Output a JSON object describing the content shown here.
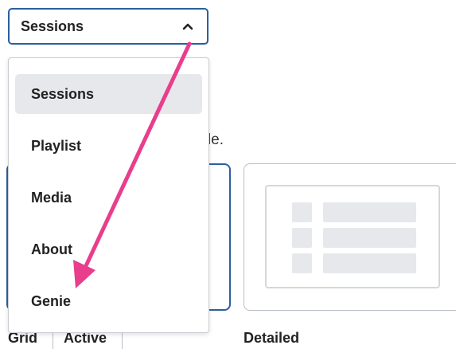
{
  "select": {
    "value": "Sessions",
    "expanded": true
  },
  "menu": {
    "items": [
      {
        "label": "Sessions",
        "selected": true
      },
      {
        "label": "Playlist",
        "selected": false
      },
      {
        "label": "Media",
        "selected": false
      },
      {
        "label": "About",
        "selected": false
      },
      {
        "label": "Genie",
        "selected": false
      }
    ]
  },
  "background": {
    "hint_fragment": "ode.",
    "cards": [
      {
        "label": "Grid",
        "badge": "Active",
        "selected": true
      },
      {
        "label": "Detailed",
        "selected": false
      }
    ]
  },
  "colors": {
    "accent_border": "#2b5fa0",
    "selected_item_bg": "#e6e8ec",
    "annotation_arrow": "#e83e8c"
  },
  "icons": {
    "select_chevron": "chevron-up-icon",
    "annotation": "pointer-arrow-icon"
  }
}
